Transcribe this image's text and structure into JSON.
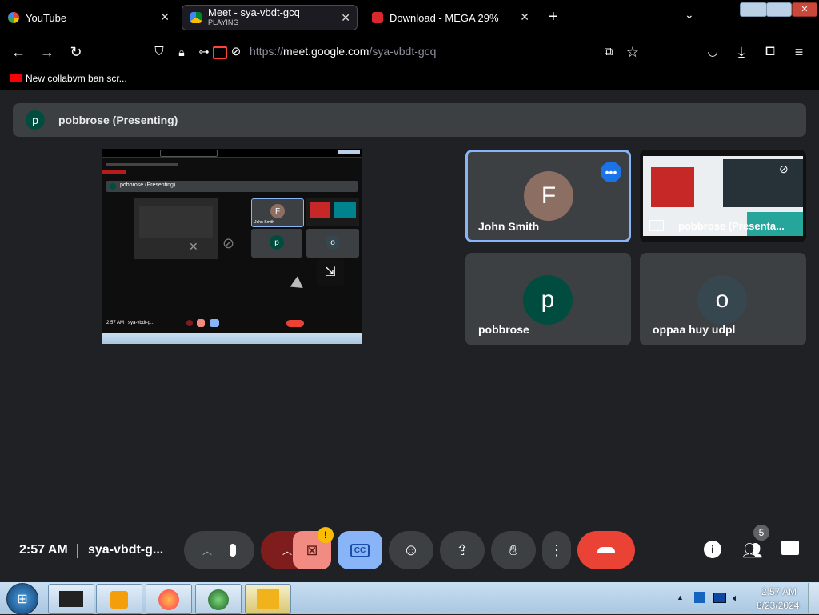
{
  "browser": {
    "tabs": [
      {
        "title": "YouTube",
        "subtitle": ""
      },
      {
        "title": "Meet - sya-vbdt-gcq",
        "subtitle": "PLAYING"
      },
      {
        "title": "Download - MEGA 29%",
        "subtitle": ""
      }
    ],
    "url_scheme": "https://",
    "url_host": "meet.google.com",
    "url_path": "/sya-vbdt-gcq",
    "bookmark": "New collabvm ban scr..."
  },
  "meet": {
    "presenter_initial": "p",
    "presenter_label": "pobbrose (Presenting)",
    "participants": [
      {
        "initial": "F",
        "name": "John Smith",
        "color": "#8d6e63"
      },
      {
        "initial": "",
        "name": "pobbrose (Presenta...",
        "color": ""
      },
      {
        "initial": "p",
        "name": "pobbrose",
        "color": "#004d40"
      },
      {
        "initial": "o",
        "name": "oppaa huy udpl",
        "color": "#37474f"
      }
    ],
    "mini": {
      "presenter_label": "pobbrose (Presenting)",
      "tile_name": "John Smith",
      "initial_f": "F",
      "initial_p": "p",
      "initial_o": "o",
      "time": "2:57 AM",
      "code": "sya-vbdt-g..."
    },
    "time": "2:57 AM",
    "meeting_code": "sya-vbdt-g...",
    "people_count": "5",
    "cc_label": "CC",
    "warning_mark": "!"
  },
  "taskbar": {
    "time": "2:57 AM",
    "date": "8/23/2024"
  },
  "colors": {
    "accent_blue": "#8ab4f8",
    "end_call_red": "#ea4335",
    "cam_off_pink": "#f28b82"
  }
}
